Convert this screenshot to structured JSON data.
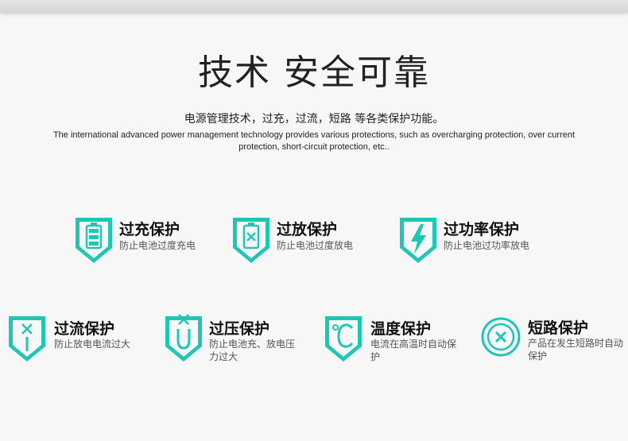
{
  "header": {
    "title": "技术 安全可靠",
    "subtitle_cn": "电源管理技术，过充，过流，短路 等各类保护功能。",
    "subtitle_en": "The international advanced power management technology provides various protections, such as overcharging protection, over current protection, short-circuit protection, etc.."
  },
  "colors": {
    "accent": "#1ec7b4",
    "accent_dark": "#14b3a0"
  },
  "features_row1": [
    {
      "icon": "battery-full-icon",
      "title": "过充保护",
      "desc": "防止电池过度充电"
    },
    {
      "icon": "battery-x-icon",
      "title": "过放保护",
      "desc": "防止电池过度放电"
    },
    {
      "icon": "lightning-icon",
      "title": "过功率保护",
      "desc": "防止电池过功率放电"
    }
  ],
  "features_row2": [
    {
      "icon": "x-current-icon",
      "title": "过流保护",
      "desc": "防止放电电流过大"
    },
    {
      "icon": "u-voltage-icon",
      "title": "过压保护",
      "desc": "防止电池充、放电压力过大"
    },
    {
      "icon": "celsius-icon",
      "title": "温度保护",
      "desc": "电流在高温时自动保护"
    },
    {
      "icon": "circle-x-icon",
      "title": "短路保护",
      "desc": "产品在发生短路时自动保护"
    }
  ]
}
